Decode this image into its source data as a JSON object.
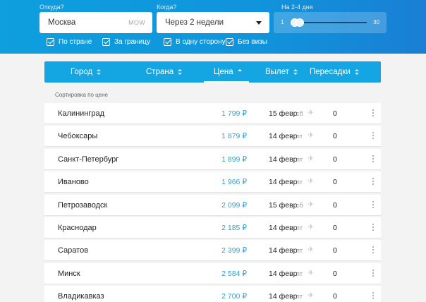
{
  "search": {
    "from_label": "Откуда?",
    "from_value": "Москва",
    "from_code": "MOW",
    "when_label": "Когда?",
    "when_value": "Через 2 недели",
    "duration_label": "На 2-4 дня",
    "duration_min": "1",
    "duration_max": "30",
    "duration_selected": [
      2,
      4
    ],
    "duration_scale": [
      1,
      30
    ]
  },
  "filters": [
    {
      "label": "По стране",
      "checked": true
    },
    {
      "label": "За границу",
      "checked": true
    },
    {
      "label": "В одну сторону",
      "checked": true
    },
    {
      "label": "Без визы",
      "checked": true
    }
  ],
  "tabs": [
    {
      "label": "Город",
      "active": false
    },
    {
      "label": "Страна",
      "active": false
    },
    {
      "label": "Цена",
      "active": true
    },
    {
      "label": "Вылет",
      "active": false
    },
    {
      "label": "Пересадки",
      "active": false
    }
  ],
  "sort_note": "Сортировка по цене",
  "results": [
    {
      "city": "Калининград",
      "price": "1 799 ₽",
      "date": "15 февр",
      "dow": "сб",
      "stops": "0"
    },
    {
      "city": "Чебоксары",
      "price": "1 879 ₽",
      "date": "14 февр",
      "dow": "пт",
      "stops": "0"
    },
    {
      "city": "Санкт-Петербург",
      "price": "1 899 ₽",
      "date": "14 февр",
      "dow": "пт",
      "stops": "0"
    },
    {
      "city": "Иваново",
      "price": "1 966 ₽",
      "date": "14 февр",
      "dow": "пт",
      "stops": "0"
    },
    {
      "city": "Петрозаводск",
      "price": "2 099 ₽",
      "date": "15 февр",
      "dow": "сб",
      "stops": "0"
    },
    {
      "city": "Краснодар",
      "price": "2 185 ₽",
      "date": "14 февр",
      "dow": "пт",
      "stops": "0"
    },
    {
      "city": "Саратов",
      "price": "2 399 ₽",
      "date": "14 февр",
      "dow": "пт",
      "stops": "0"
    },
    {
      "city": "Минск",
      "price": "2 584 ₽",
      "date": "14 февр",
      "dow": "пт",
      "stops": "0"
    },
    {
      "city": "Владикавказ",
      "price": "2 700 ₽",
      "date": "14 февр",
      "dow": "пт",
      "stops": "0"
    }
  ],
  "icons": {
    "dropdown": "chevron-down-icon",
    "sort": "sort-arrows-icon",
    "plane": "plane-icon",
    "more": "more-vertical-icon",
    "checkbox": "checkbox-checked-icon"
  },
  "colors": {
    "header": "#0e9fde",
    "tab_bar": "#14a6e3",
    "price": "#2ba3dd"
  }
}
